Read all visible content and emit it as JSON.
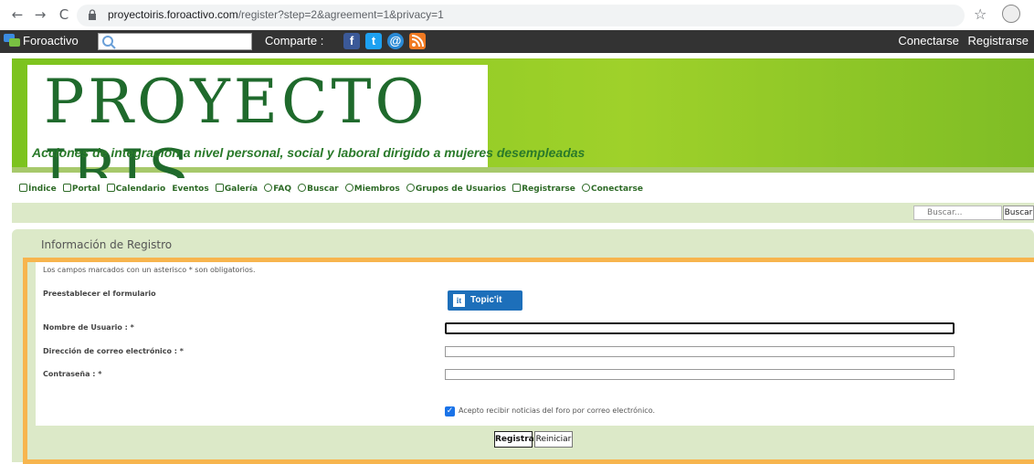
{
  "browser": {
    "url_domain": "proyectoiris.foroactivo.com",
    "url_path": "/register?step=2&agreement=1&privacy=1",
    "back_glyph": "←",
    "forward_glyph": "→",
    "reload_glyph": "C",
    "star_glyph": "☆"
  },
  "topbar": {
    "brand": "Foroactivo",
    "share_label": "Comparte :",
    "social": [
      {
        "glyph": "f",
        "color": "#3b5998"
      },
      {
        "glyph": "t",
        "color": "#1da1f2"
      },
      {
        "glyph": "@",
        "color": "#2a8ad6"
      },
      {
        "glyph": "",
        "color": "#f07a22"
      }
    ],
    "login": "Conectarse",
    "register": "Registrarse"
  },
  "banner": {
    "title": "PROYECTO IRIS",
    "subtitle": "Acciones de integración a nivel personal, social y laboral  dirigido a mujeres desempleadas",
    "bg_color": "#8fcb24",
    "title_color": "#1f6a2c"
  },
  "menu": {
    "items": [
      "Índice",
      "Portal",
      "Calendario",
      "Eventos",
      "Galería",
      "FAQ",
      "Buscar",
      "Miembros",
      "Grupos de Usuarios",
      "Registrarse",
      "Conectarse"
    ]
  },
  "search": {
    "placeholder": "Buscar...",
    "button": "Buscar"
  },
  "panel": {
    "title": "Información de Registro",
    "required_note": "Los campos marcados con un asterisco * son obligatorios.",
    "prefill_label": "Preestablecer el formulario",
    "topicit_label": "Topic'it",
    "fields": [
      {
        "label": "Nombre de Usuario : *",
        "value": ""
      },
      {
        "label": "Dirección de correo electrónico : *",
        "value": ""
      },
      {
        "label": "Contraseña : *",
        "value": ""
      }
    ],
    "newsletter_label": "Acepto recibir noticias del foro por correo electrónico.",
    "newsletter_checked": true,
    "submit": "Registrar",
    "reset": "Reiniciar",
    "frame_color": "#f7b54e"
  }
}
